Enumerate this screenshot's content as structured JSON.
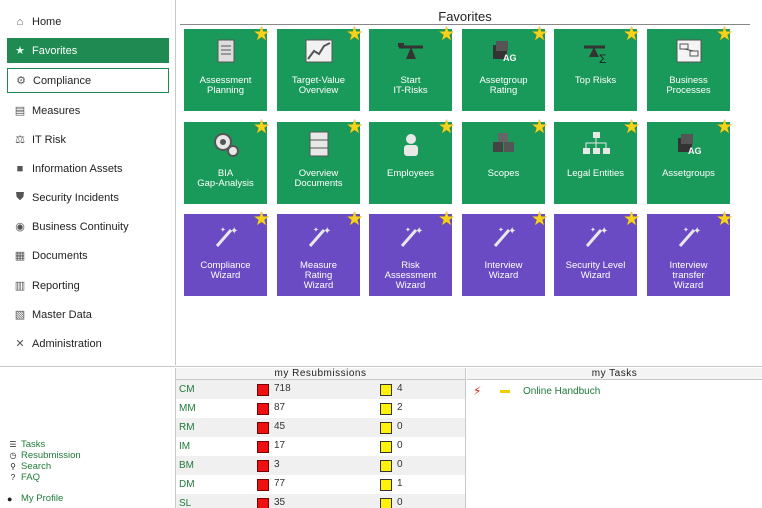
{
  "sidebar": {
    "items": [
      {
        "label": "Home",
        "icon": "home-icon",
        "glyph": "⌂"
      },
      {
        "label": "Favorites",
        "icon": "star-icon",
        "glyph": "★"
      },
      {
        "label": "Compliance",
        "icon": "gears-icon",
        "glyph": "⚙"
      },
      {
        "label": "Measures",
        "icon": "document-icon",
        "glyph": "▤"
      },
      {
        "label": "IT Risk",
        "icon": "network-icon",
        "glyph": "⚖"
      },
      {
        "label": "Information Assets",
        "icon": "server-icon",
        "glyph": "■"
      },
      {
        "label": "Security Incidents",
        "icon": "shield-icon",
        "glyph": "⛊"
      },
      {
        "label": "Business Continuity",
        "icon": "globe-icon",
        "glyph": "◉"
      },
      {
        "label": "Documents",
        "icon": "folder-icon",
        "glyph": "▦"
      },
      {
        "label": "Reporting",
        "icon": "report-icon",
        "glyph": "▥"
      },
      {
        "label": "Master Data",
        "icon": "database-icon",
        "glyph": "▧"
      },
      {
        "label": "Administration",
        "icon": "tools-icon",
        "glyph": "✕"
      }
    ]
  },
  "favorites": {
    "title": "Favorites",
    "tiles": [
      {
        "label": "Assessment\nPlanning",
        "color": "green",
        "icon": "clipboard-icon"
      },
      {
        "label": "Target-Value\nOverview",
        "color": "green",
        "icon": "chart-icon"
      },
      {
        "label": "Start\nIT-Risks",
        "color": "green",
        "icon": "scale-icon"
      },
      {
        "label": "Assetgroup\nRating",
        "color": "green",
        "icon": "assetgroup-icon"
      },
      {
        "label": "Top Risks",
        "color": "green",
        "icon": "sigma-icon"
      },
      {
        "label": "Business\nProcesses",
        "color": "green",
        "icon": "process-icon"
      },
      {
        "label": "BIA\nGap-Analysis",
        "color": "green",
        "icon": "gears-icon"
      },
      {
        "label": "Overview\nDocuments",
        "color": "green",
        "icon": "cabinet-icon"
      },
      {
        "label": "Employees",
        "color": "green",
        "icon": "person-icon"
      },
      {
        "label": "Scopes",
        "color": "green",
        "icon": "cubes-icon"
      },
      {
        "label": "Legal Entities",
        "color": "green",
        "icon": "org-chart-icon"
      },
      {
        "label": "Assetgroups",
        "color": "green",
        "icon": "assetgroup-icon"
      },
      {
        "label": "Compliance\nWizard",
        "color": "purple",
        "icon": "wand-icon"
      },
      {
        "label": "Measure\nRating\nWizard",
        "color": "purple",
        "icon": "wand-icon"
      },
      {
        "label": "Risk\nAssessment\nWizard",
        "color": "purple",
        "icon": "wand-icon"
      },
      {
        "label": "Interview\nWizard",
        "color": "purple",
        "icon": "wand-icon"
      },
      {
        "label": "Security Level\nWizard",
        "color": "purple",
        "icon": "wand-icon"
      },
      {
        "label": "Interview\ntransfer\nWizard",
        "color": "purple",
        "icon": "wand-icon"
      }
    ]
  },
  "links": {
    "tasks": "Tasks",
    "resubmission": "Resubmission",
    "search": "Search",
    "faq": "FAQ",
    "profile": "My Profile"
  },
  "resubmissions": {
    "title": "my Resubmissions",
    "rows": [
      {
        "code": "CM",
        "red": "718",
        "yellow": "4"
      },
      {
        "code": "MM",
        "red": "87",
        "yellow": "2"
      },
      {
        "code": "RM",
        "red": "45",
        "yellow": "0"
      },
      {
        "code": "IM",
        "red": "17",
        "yellow": "0"
      },
      {
        "code": "BM",
        "red": "3",
        "yellow": "0"
      },
      {
        "code": "DM",
        "red": "77",
        "yellow": "1"
      },
      {
        "code": "SL",
        "red": "35",
        "yellow": "0"
      }
    ]
  },
  "tasks": {
    "title": "my Tasks",
    "items": [
      {
        "label": "Online Handbuch"
      }
    ]
  },
  "colors": {
    "green": "#1a9a5a",
    "purple": "#6a4bc4",
    "star": "#f7d21c",
    "link": "#1f7a3a"
  }
}
